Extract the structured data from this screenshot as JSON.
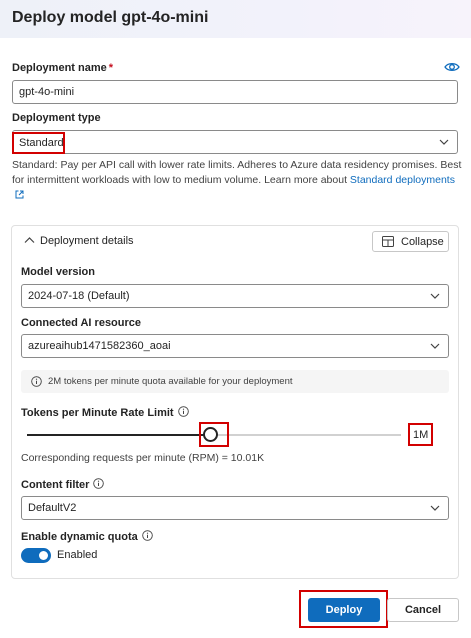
{
  "title": "Deploy model gpt-4o-mini",
  "deployment_name": {
    "label": "Deployment name",
    "required_mark": "*",
    "value": "gpt-4o-mini"
  },
  "deployment_type": {
    "label": "Deployment type",
    "value": "Standard",
    "description": "Standard: Pay per API call with lower rate limits. Adheres to Azure data residency promises. Best for intermittent workloads with low to medium volume. Learn more about",
    "link_text": "Standard deployments"
  },
  "panel": {
    "heading": "Deployment details",
    "collapse_label": "Collapse",
    "model_version": {
      "label": "Model version",
      "value": "2024-07-18 (Default)"
    },
    "ai_resource": {
      "label": "Connected AI resource",
      "value": "azureaihub1471582360_aoai"
    },
    "quota_info": "2M tokens per minute quota available for your deployment",
    "rate_limit": {
      "label": "Tokens per Minute Rate Limit",
      "fraction": 0.49,
      "max_label": "1M",
      "rpm_text": "Corresponding requests per minute (RPM) = 10.01K"
    },
    "content_filter": {
      "label": "Content filter",
      "value": "DefaultV2"
    },
    "dynamic_quota": {
      "label": "Enable dynamic quota",
      "state_label": "Enabled",
      "enabled": true
    }
  },
  "actions": {
    "deploy_label": "Deploy",
    "cancel_label": "Cancel"
  },
  "colors": {
    "accent": "#0f6cbd",
    "highlight": "#d20000",
    "required": "#c50f1f"
  },
  "icons": [
    "eye-icon",
    "chevron-down-icon",
    "chevron-up-icon",
    "open-external-icon",
    "collapse-panel-icon",
    "info-icon"
  ]
}
